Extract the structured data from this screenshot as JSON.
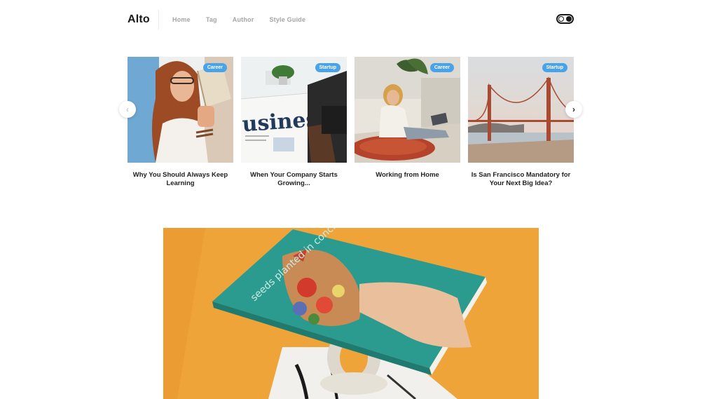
{
  "header": {
    "logo": "Alto",
    "nav": [
      "Home",
      "Tag",
      "Author",
      "Style Guide"
    ]
  },
  "carousel": {
    "cards": [
      {
        "tag": "Career",
        "title": "Why You Should Always Keep Learning"
      },
      {
        "tag": "Startup",
        "title": "When Your Company Starts Growing..."
      },
      {
        "tag": "Career",
        "title": "Working from Home"
      },
      {
        "tag": "Startup",
        "title": "Is San Francisco Mandatory for Your Next Big Idea?"
      }
    ]
  },
  "feature": {
    "book_title": "seeds planted in concrete"
  },
  "colors": {
    "accent": "#4aa3e8",
    "feature_bg": "#efa43a",
    "book_cover": "#2b9b8f"
  },
  "icons": {
    "prev": "chevron-left-icon",
    "next": "chevron-right-icon",
    "theme": "theme-toggle-icon"
  }
}
